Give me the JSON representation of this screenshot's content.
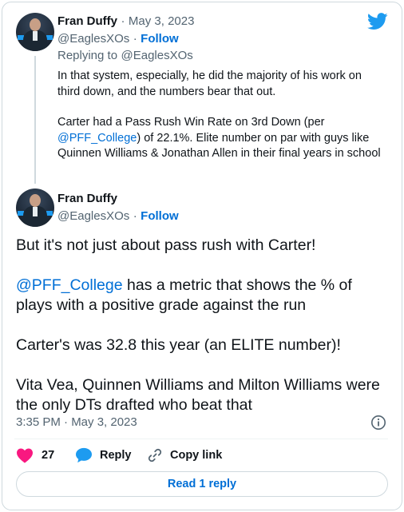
{
  "reply_tweet": {
    "display_name": "Fran Duffy",
    "separator": "·",
    "date": "May 3, 2023",
    "handle": "@EaglesXOs",
    "follow_separator": "·",
    "follow_label": "Follow",
    "replying_to_prefix": "Replying to",
    "replying_to_handle": "@EaglesXOs",
    "paragraph1": "In that system, especially, he did the majority of his work on third down, and the numbers bear that out.",
    "paragraph2_pre": "Carter had a Pass Rush Win Rate on 3rd Down (per ",
    "paragraph2_mention": "@PFF_College",
    "paragraph2_post": ") of 22.1%. Elite number on par with guys like Quinnen Williams & Jonathan Allen in their final years in school"
  },
  "main_tweet": {
    "display_name": "Fran Duffy",
    "handle": "@EaglesXOs",
    "follow_separator": "·",
    "follow_label": "Follow",
    "paragraph1": "But it's not just about pass rush with Carter!",
    "paragraph2_mention": "@PFF_College",
    "paragraph2_post": " has a metric that shows the % of plays with a positive grade against the run",
    "paragraph3": "Carter's was 32.8 this year (an ELITE number)!",
    "paragraph4": "Vita Vea, Quinnen Williams and Milton Williams were the only DTs drafted who beat that",
    "timestamp": "3:35 PM · May 3, 2023"
  },
  "actions": {
    "like_count": "27",
    "reply_label": "Reply",
    "copy_link_label": "Copy link"
  },
  "read_reply_label": "Read 1 reply",
  "icons": {
    "brand": "twitter-bird-icon",
    "like": "heart-icon",
    "reply": "speech-bubble-icon",
    "copy_link": "link-icon",
    "info": "info-icon"
  },
  "colors": {
    "twitter_blue": "#1d9bf0",
    "link_blue": "#006fd6",
    "like_pink": "#f91880",
    "muted_text": "#536471",
    "border": "#cfd9de"
  }
}
